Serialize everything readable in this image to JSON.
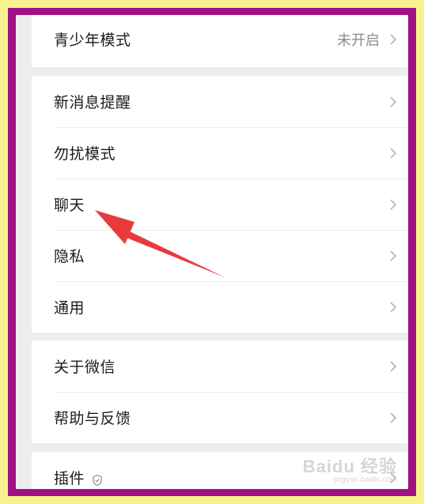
{
  "settings": {
    "teen_mode": {
      "label": "青少年模式",
      "value": "未开启"
    },
    "new_message": {
      "label": "新消息提醒"
    },
    "dnd": {
      "label": "勿扰模式"
    },
    "chat": {
      "label": "聊天"
    },
    "privacy": {
      "label": "隐私"
    },
    "general": {
      "label": "通用"
    },
    "about": {
      "label": "关于微信"
    },
    "help": {
      "label": "帮助与反馈"
    },
    "plugins": {
      "label": "插件"
    }
  },
  "watermark": {
    "logo": "Baidu 经验",
    "site": "jingyan.baidu.com"
  },
  "colors": {
    "outer_border": "#f6f38e",
    "inner_frame": "#a01283",
    "annotation_arrow": "#e83a3a"
  }
}
